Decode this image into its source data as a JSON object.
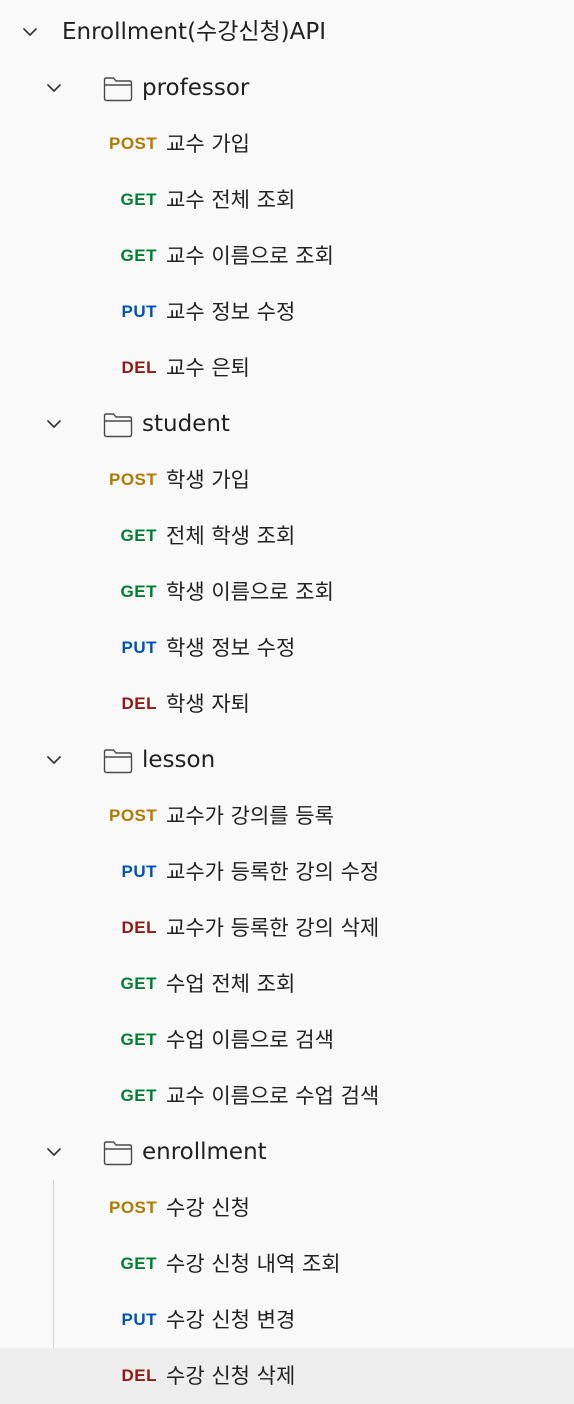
{
  "collection": {
    "title": "Enrollment(수강신청)API",
    "folders": [
      {
        "name": "professor",
        "requests": [
          {
            "method": "POST",
            "name": "교수 가입"
          },
          {
            "method": "GET",
            "name": "교수 전체 조회"
          },
          {
            "method": "GET",
            "name": "교수 이름으로 조회"
          },
          {
            "method": "PUT",
            "name": "교수 정보 수정"
          },
          {
            "method": "DEL",
            "name": "교수 은퇴"
          }
        ]
      },
      {
        "name": "student",
        "requests": [
          {
            "method": "POST",
            "name": "학생 가입"
          },
          {
            "method": "GET",
            "name": "전체 학생 조회"
          },
          {
            "method": "GET",
            "name": "학생 이름으로 조회"
          },
          {
            "method": "PUT",
            "name": "학생 정보 수정"
          },
          {
            "method": "DEL",
            "name": "학생 자퇴"
          }
        ]
      },
      {
        "name": "lesson",
        "requests": [
          {
            "method": "POST",
            "name": "교수가 강의를 등록"
          },
          {
            "method": "PUT",
            "name": "교수가 등록한 강의 수정"
          },
          {
            "method": "DEL",
            "name": "교수가 등록한 강의 삭제"
          },
          {
            "method": "GET",
            "name": "수업 전체 조회"
          },
          {
            "method": "GET",
            "name": "수업 이름으로 검색"
          },
          {
            "method": "GET",
            "name": "교수 이름으로 수업 검색"
          }
        ]
      },
      {
        "name": "enrollment",
        "requests": [
          {
            "method": "POST",
            "name": "수강 신청"
          },
          {
            "method": "GET",
            "name": "수강 신청 내역 조회"
          },
          {
            "method": "PUT",
            "name": "수강 신청 변경"
          },
          {
            "method": "DEL",
            "name": "수강 신청 삭제",
            "selected": true
          }
        ]
      }
    ]
  },
  "icons": {
    "expand": "chevron-down-icon",
    "folder": "folder-icon"
  },
  "colors": {
    "POST": "#ad7a03",
    "GET": "#007f31",
    "PUT": "#0053b8",
    "DEL": "#8e1a10",
    "selected_row": "#ededed"
  }
}
